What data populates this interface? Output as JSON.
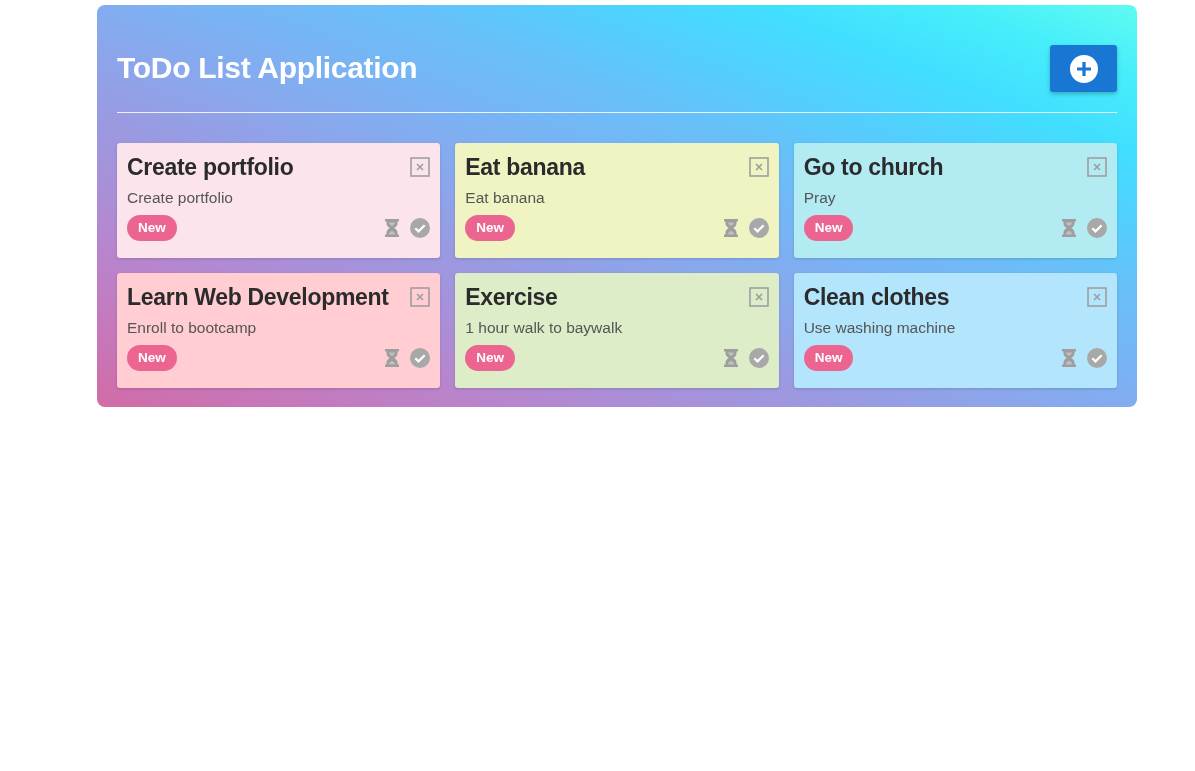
{
  "header": {
    "title": "ToDo List Application"
  },
  "todos": [
    {
      "title": "Create portfolio",
      "description": "Create portfolio",
      "status": "New",
      "color": "#fce4ec"
    },
    {
      "title": "Eat banana",
      "description": "Eat banana",
      "status": "New",
      "color": "#f0f4c3"
    },
    {
      "title": "Go to church",
      "description": "Pray",
      "status": "New",
      "color": "#b2ebf2"
    },
    {
      "title": "Learn Web Development",
      "description": "Enroll to bootcamp",
      "status": "New",
      "color": "#ffcdd2"
    },
    {
      "title": "Exercise",
      "description": "1 hour walk to baywalk",
      "status": "New",
      "color": "#dcedc8"
    },
    {
      "title": "Clean clothes",
      "description": "Use washing machine",
      "status": "New",
      "color": "#b3e5fc"
    }
  ]
}
